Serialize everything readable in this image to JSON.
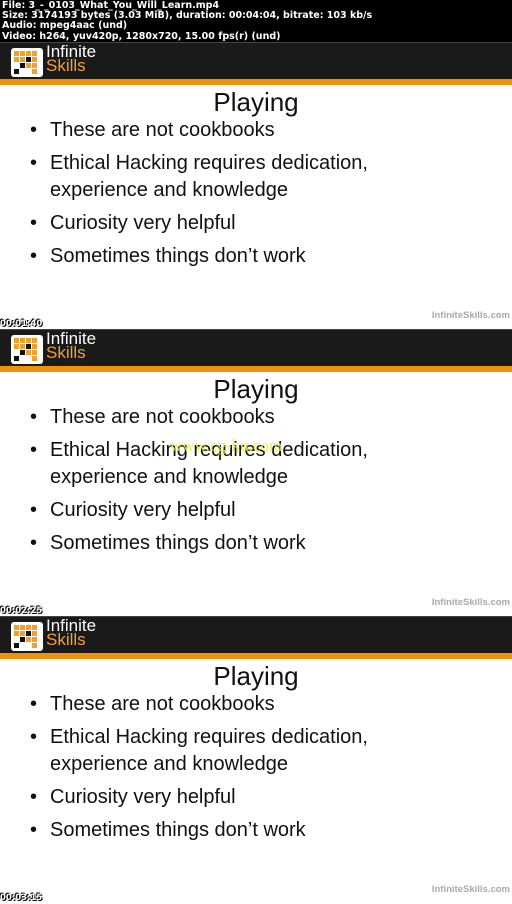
{
  "info": {
    "line1": "File: 3_-_0103_What_You_Will_Learn.mp4",
    "line2": "Size: 3174193 bytes (3.03 MiB), duration: 00:04:04, bitrate: 103 kb/s",
    "line3": "Audio: mpeg4aac (und)",
    "line4": "Video: h264, yuv420p, 1280x720, 15.00 fps(r) (und)"
  },
  "brand": {
    "line1": "Infinite",
    "line2": "Skills",
    "site": "InfiniteSkills.com",
    "colors": {
      "orange": "#f0900f",
      "header": "#1a1a1a"
    }
  },
  "slide": {
    "title": "Playing",
    "bullets": [
      "These are not cookbooks",
      "Ethical Hacking requires dedication, experience and knowledge",
      "Curiosity very helpful",
      "Sometimes things don’t work"
    ]
  },
  "frames": [
    {
      "timestamp": "00:01:40"
    },
    {
      "timestamp": "00:02:25",
      "watermark": "www.cg-ku.com"
    },
    {
      "timestamp": "00:03:15"
    }
  ]
}
